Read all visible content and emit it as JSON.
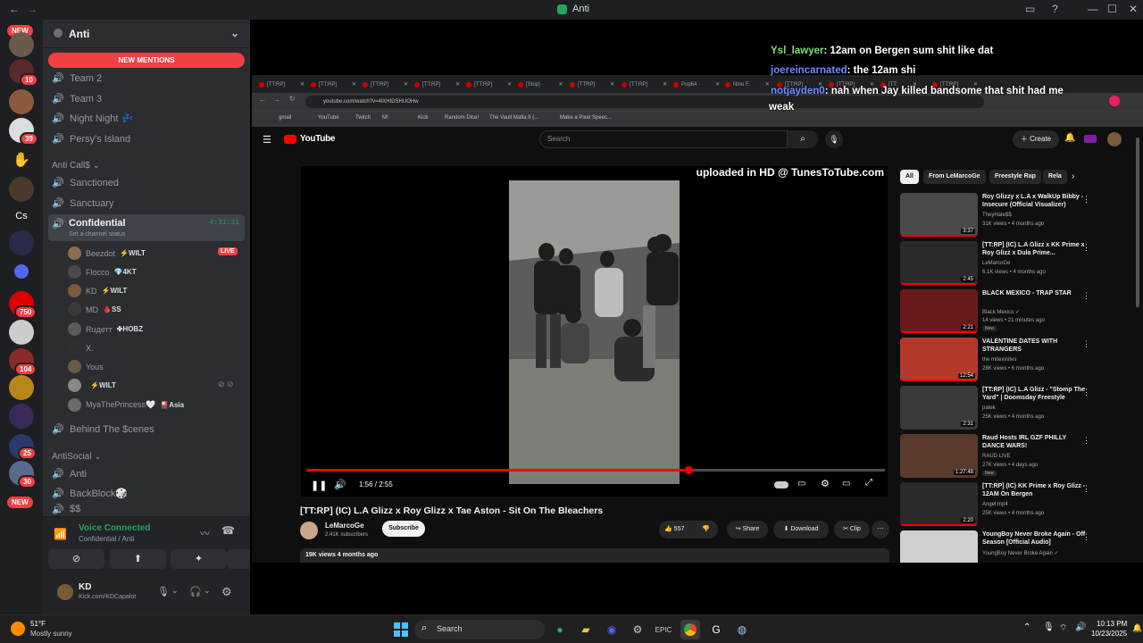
{
  "window": {
    "title": "Anti",
    "back": "←",
    "forward": "→",
    "minimize": "—",
    "maximize": "☐",
    "close": "✕"
  },
  "servers": {
    "new_top": "NEW",
    "new_bottom": "NEW",
    "badges": [
      "10",
      "39",
      "750",
      "104",
      "25",
      "30"
    ],
    "letters_cs": "Cs"
  },
  "guild": {
    "name": "Anti",
    "new_mentions": "NEW MENTIONS",
    "channels_top": [
      "Team 2",
      "Team 3",
      "Night Night 💤",
      "Persy's Island"
    ],
    "category_calls": "Anti Call$",
    "channels_calls": [
      "Sanctioned",
      "Sanctuary"
    ],
    "active_channel": "Confidential",
    "active_timer": "4:31:31",
    "status_hint": "Set a channel status",
    "users": [
      {
        "name": "Beezdot",
        "tag": "⚡WILT",
        "color": "#8a6d4a",
        "live": "LIVE"
      },
      {
        "name": "Flocco",
        "tag": "💎4KT",
        "color": "#4a4a4a"
      },
      {
        "name": "KD",
        "tag": "⚡WILT",
        "color": "#7b5a3a"
      },
      {
        "name": "MD",
        "tag": "🩸SS",
        "color": "#3a3a3a"
      },
      {
        "name": "Ruдетт",
        "tag": "✤HOBZ",
        "color": "#5a5a5a"
      },
      {
        "name": "X.",
        "tag": "",
        "color": "#2f2f2f"
      },
      {
        "name": "Yous",
        "tag": "",
        "color": "#6a5a4a"
      },
      {
        "name": "",
        "tag": "⚡WILT",
        "color": "#888888"
      },
      {
        "name": "MyaThePrincess🤍",
        "tag": "🎴Asia",
        "color": "#6b6b6b"
      }
    ],
    "channel_scenes": "Behind The $cenes",
    "category_social": "AntiSocial",
    "channels_social": [
      "Anti",
      "BackBlock🎲",
      "$$"
    ]
  },
  "voice": {
    "status": "Voice Connected",
    "location": "Confidential / Anti"
  },
  "user": {
    "name": "KD",
    "subtitle": "Kick.com/KDCapalot"
  },
  "chat": [
    {
      "user": "Ysl_lawyer",
      "color": "#7ce07a",
      "msg": ": 12am on Bergen sum shit like dat"
    },
    {
      "user": "joereincarnated",
      "color": "#6f8dff",
      "msg": ": the 12am shi"
    },
    {
      "user": "notjayden0",
      "color": "#6f8dff",
      "msg": ": nah when Jay killed bandsome that shit had me"
    },
    {
      "user": "",
      "color": "#ffffff",
      "msg": "weak"
    }
  ],
  "browser": {
    "tabs": [
      "[TT:RP]",
      "[TT:RP]",
      "[TT:RP]",
      "[TT:RP]",
      "[TT:RP]",
      "[Stop] ·",
      "[TTRP]",
      "[TT:RP]",
      "Pop64 ·",
      "Nino F.",
      "[TT:RP]",
      "[TT:RP]",
      "[TT:",
      "[TT:RP]"
    ],
    "url": "youtube.com/watch?v=4lXHIDSHUOHw",
    "bookmarks": [
      "gmail",
      "YouTube",
      "Twitch",
      "M!",
      "Kick",
      "Random Dice!",
      "The Vault Mafia II (...",
      "Make a Pixel Speec..."
    ]
  },
  "youtube": {
    "logo": "YouTube",
    "search_placeholder": "Search",
    "create": "Create",
    "watermark": "uploaded in HD @ TunesToTube.com",
    "time": "1:56 / 2:55",
    "progress": 0.66,
    "title": "[TT:RP] (IC) L.A Glizz x Roy Glizz x Tae Aston - Sit On The Bleachers",
    "channel": "LeMarcoGe",
    "subs": "2.41K subscribers",
    "subscribe": "Subscribe",
    "likes": "557",
    "share": "Share",
    "download": "Download",
    "clip": "Clip",
    "views": "19K views  4 months ago",
    "chips": [
      "All",
      "From LeMarcoGe",
      "Freestyle Rap",
      "Rela"
    ],
    "recs": [
      {
        "title": "Roy Glizzy x L.A x WalkUp Bibby - Insecure (Official Visualizer)",
        "channel": "TheyHate$$",
        "meta": "31K views • 4 months ago",
        "dur": "3:37",
        "color": "#4a4a4a"
      },
      {
        "title": "[TT:RP] (IC) L.A Glizz x KK Prime x Roy Glizz x Dula Prime...",
        "channel": "LeMarcoGe",
        "meta": "6.1K views • 4 months ago",
        "dur": "2:45",
        "color": "#2a2a2a"
      },
      {
        "title": "BLACK MEXICO - TRAP STAR",
        "channel": "Black Mexico ✓",
        "meta": "14 views • 21 minutes ago",
        "dur": "2:21",
        "badge": "New",
        "color": "#6a1a1a"
      },
      {
        "title": "VALENTINE DATES WITH STRANGERS",
        "channel": "the mitexinites",
        "meta": "28K views • 6 months ago",
        "dur": "12:54",
        "color": "#b33a2a"
      },
      {
        "title": "[TT:RP] (IC) L.A Glizz - \"Stomp The Yard\" | Doomsday Freestyle",
        "channel": "patek",
        "meta": "25K views • 4 months ago",
        "dur": "2:31",
        "color": "#3a3a3a"
      },
      {
        "title": "Raud Hosts IRL GZF PHILLY DANCE WARS!",
        "channel": "RAUD LIVE",
        "meta": "27K views • 4 days ago",
        "dur": "1:27:48",
        "badge": "New",
        "color": "#5a3a2a"
      },
      {
        "title": "[TT:RP] (IC) KK Prime x Roy Glizz - 12AM On Bergen",
        "channel": "Angel.mp4",
        "meta": "25K views • 4 months ago",
        "dur": "2:20",
        "color": "#2a2a2a"
      },
      {
        "title": "YoungBoy Never Broke Again - Off Season [Official Audio]",
        "channel": "YoungBoy Never Broke Again ✓",
        "meta": "",
        "dur": "",
        "color": "#cfcfcf"
      }
    ]
  },
  "taskbar": {
    "weather_temp": "51°F",
    "weather_desc": "Mostly sunny",
    "search": "Search",
    "time": "10:13 PM",
    "date": "10/23/2025"
  }
}
